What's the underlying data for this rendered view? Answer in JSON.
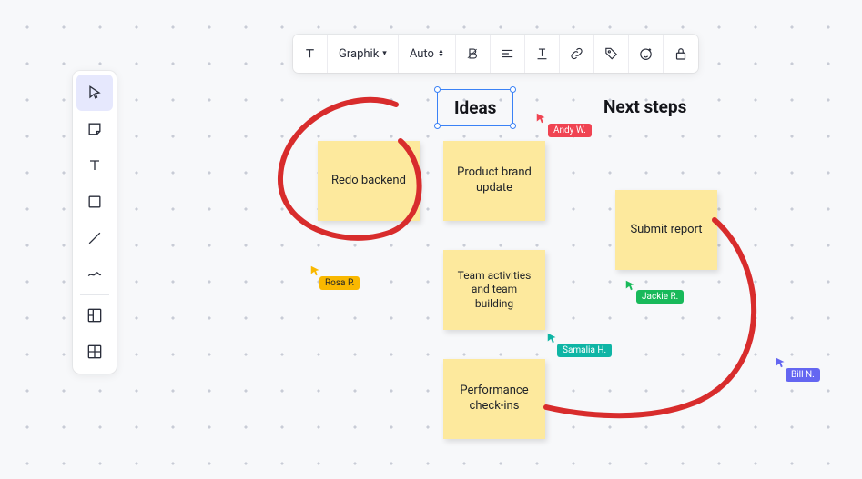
{
  "toolbar_h": {
    "font": "Graphik",
    "size": "Auto"
  },
  "headings": {
    "ideas": "Ideas",
    "next_steps": "Next steps"
  },
  "stickies": {
    "redo_backend": "Redo backend",
    "product_brand": "Product brand update",
    "team_activities": "Team activities and team building",
    "performance": "Performance check-ins",
    "submit_report": "Submit report"
  },
  "users": {
    "andy": {
      "name": "Andy W.",
      "color": "#f04452"
    },
    "rosa": {
      "name": "Rosa P.",
      "color": "#f9b800"
    },
    "jackie": {
      "name": "Jackie R.",
      "color": "#18b95a"
    },
    "samalia": {
      "name": "Samalia H.",
      "color": "#0fb5a5"
    },
    "bill": {
      "name": "Bill N.",
      "color": "#6466f1"
    }
  }
}
